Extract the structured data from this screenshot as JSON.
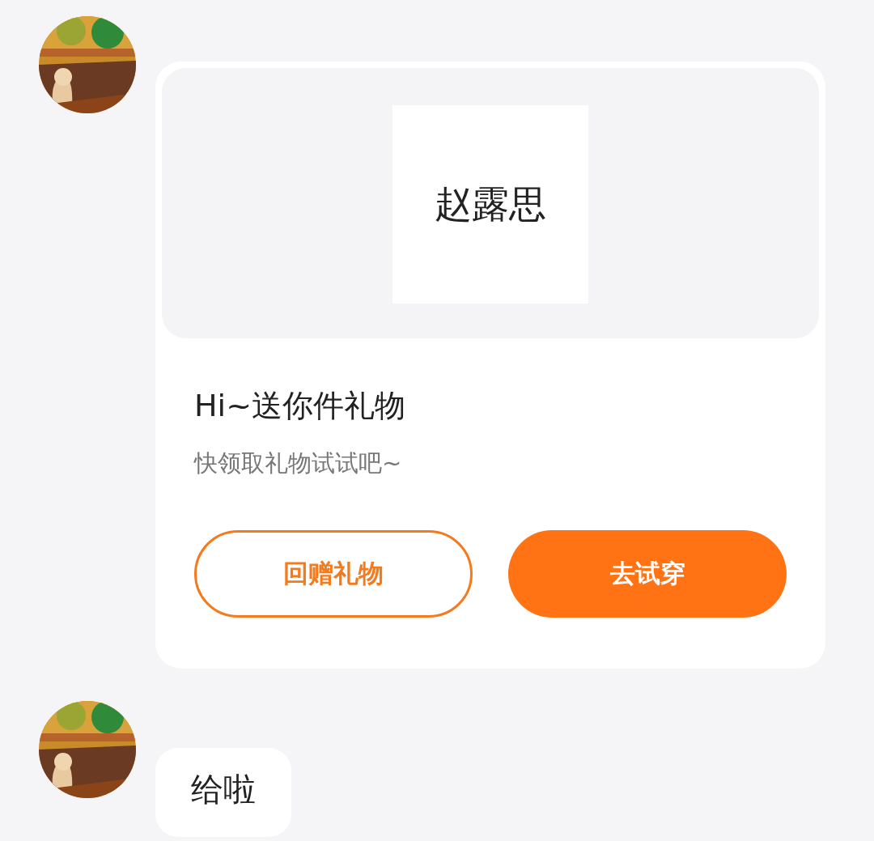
{
  "messages": [
    {
      "kind": "gift",
      "gift_name": "赵露思",
      "title": "Hi~送你件礼物",
      "subtitle": "快领取礼物试试吧~",
      "buttons": [
        {
          "label": "回赠礼物",
          "kind": "outline"
        },
        {
          "label": "去试穿",
          "kind": "filled"
        }
      ]
    },
    {
      "kind": "text",
      "text": "给啦"
    }
  ]
}
